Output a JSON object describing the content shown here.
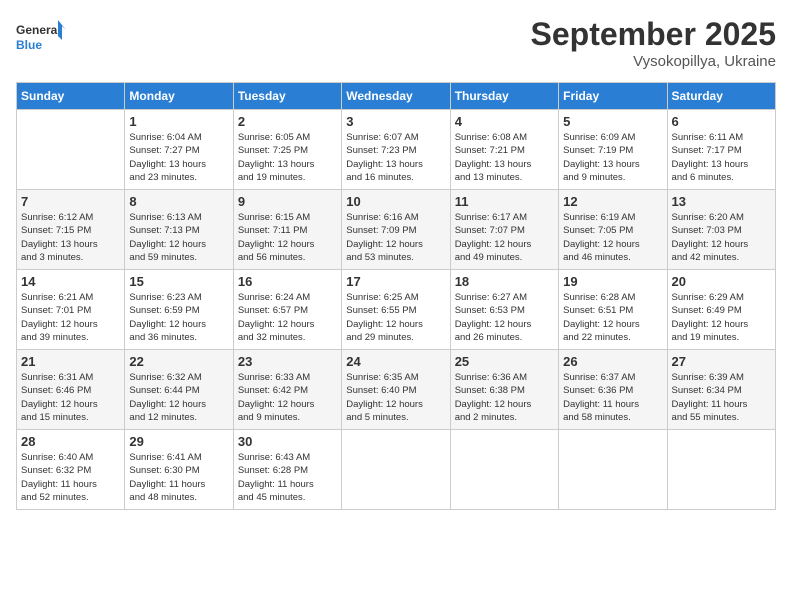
{
  "logo": {
    "line1": "General",
    "line2": "Blue"
  },
  "title": "September 2025",
  "subtitle": "Vysokopillya, Ukraine",
  "header_days": [
    "Sunday",
    "Monday",
    "Tuesday",
    "Wednesday",
    "Thursday",
    "Friday",
    "Saturday"
  ],
  "weeks": [
    [
      {
        "day": "",
        "info": ""
      },
      {
        "day": "1",
        "info": "Sunrise: 6:04 AM\nSunset: 7:27 PM\nDaylight: 13 hours\nand 23 minutes."
      },
      {
        "day": "2",
        "info": "Sunrise: 6:05 AM\nSunset: 7:25 PM\nDaylight: 13 hours\nand 19 minutes."
      },
      {
        "day": "3",
        "info": "Sunrise: 6:07 AM\nSunset: 7:23 PM\nDaylight: 13 hours\nand 16 minutes."
      },
      {
        "day": "4",
        "info": "Sunrise: 6:08 AM\nSunset: 7:21 PM\nDaylight: 13 hours\nand 13 minutes."
      },
      {
        "day": "5",
        "info": "Sunrise: 6:09 AM\nSunset: 7:19 PM\nDaylight: 13 hours\nand 9 minutes."
      },
      {
        "day": "6",
        "info": "Sunrise: 6:11 AM\nSunset: 7:17 PM\nDaylight: 13 hours\nand 6 minutes."
      }
    ],
    [
      {
        "day": "7",
        "info": "Sunrise: 6:12 AM\nSunset: 7:15 PM\nDaylight: 13 hours\nand 3 minutes."
      },
      {
        "day": "8",
        "info": "Sunrise: 6:13 AM\nSunset: 7:13 PM\nDaylight: 12 hours\nand 59 minutes."
      },
      {
        "day": "9",
        "info": "Sunrise: 6:15 AM\nSunset: 7:11 PM\nDaylight: 12 hours\nand 56 minutes."
      },
      {
        "day": "10",
        "info": "Sunrise: 6:16 AM\nSunset: 7:09 PM\nDaylight: 12 hours\nand 53 minutes."
      },
      {
        "day": "11",
        "info": "Sunrise: 6:17 AM\nSunset: 7:07 PM\nDaylight: 12 hours\nand 49 minutes."
      },
      {
        "day": "12",
        "info": "Sunrise: 6:19 AM\nSunset: 7:05 PM\nDaylight: 12 hours\nand 46 minutes."
      },
      {
        "day": "13",
        "info": "Sunrise: 6:20 AM\nSunset: 7:03 PM\nDaylight: 12 hours\nand 42 minutes."
      }
    ],
    [
      {
        "day": "14",
        "info": "Sunrise: 6:21 AM\nSunset: 7:01 PM\nDaylight: 12 hours\nand 39 minutes."
      },
      {
        "day": "15",
        "info": "Sunrise: 6:23 AM\nSunset: 6:59 PM\nDaylight: 12 hours\nand 36 minutes."
      },
      {
        "day": "16",
        "info": "Sunrise: 6:24 AM\nSunset: 6:57 PM\nDaylight: 12 hours\nand 32 minutes."
      },
      {
        "day": "17",
        "info": "Sunrise: 6:25 AM\nSunset: 6:55 PM\nDaylight: 12 hours\nand 29 minutes."
      },
      {
        "day": "18",
        "info": "Sunrise: 6:27 AM\nSunset: 6:53 PM\nDaylight: 12 hours\nand 26 minutes."
      },
      {
        "day": "19",
        "info": "Sunrise: 6:28 AM\nSunset: 6:51 PM\nDaylight: 12 hours\nand 22 minutes."
      },
      {
        "day": "20",
        "info": "Sunrise: 6:29 AM\nSunset: 6:49 PM\nDaylight: 12 hours\nand 19 minutes."
      }
    ],
    [
      {
        "day": "21",
        "info": "Sunrise: 6:31 AM\nSunset: 6:46 PM\nDaylight: 12 hours\nand 15 minutes."
      },
      {
        "day": "22",
        "info": "Sunrise: 6:32 AM\nSunset: 6:44 PM\nDaylight: 12 hours\nand 12 minutes."
      },
      {
        "day": "23",
        "info": "Sunrise: 6:33 AM\nSunset: 6:42 PM\nDaylight: 12 hours\nand 9 minutes."
      },
      {
        "day": "24",
        "info": "Sunrise: 6:35 AM\nSunset: 6:40 PM\nDaylight: 12 hours\nand 5 minutes."
      },
      {
        "day": "25",
        "info": "Sunrise: 6:36 AM\nSunset: 6:38 PM\nDaylight: 12 hours\nand 2 minutes."
      },
      {
        "day": "26",
        "info": "Sunrise: 6:37 AM\nSunset: 6:36 PM\nDaylight: 11 hours\nand 58 minutes."
      },
      {
        "day": "27",
        "info": "Sunrise: 6:39 AM\nSunset: 6:34 PM\nDaylight: 11 hours\nand 55 minutes."
      }
    ],
    [
      {
        "day": "28",
        "info": "Sunrise: 6:40 AM\nSunset: 6:32 PM\nDaylight: 11 hours\nand 52 minutes."
      },
      {
        "day": "29",
        "info": "Sunrise: 6:41 AM\nSunset: 6:30 PM\nDaylight: 11 hours\nand 48 minutes."
      },
      {
        "day": "30",
        "info": "Sunrise: 6:43 AM\nSunset: 6:28 PM\nDaylight: 11 hours\nand 45 minutes."
      },
      {
        "day": "",
        "info": ""
      },
      {
        "day": "",
        "info": ""
      },
      {
        "day": "",
        "info": ""
      },
      {
        "day": "",
        "info": ""
      }
    ]
  ]
}
